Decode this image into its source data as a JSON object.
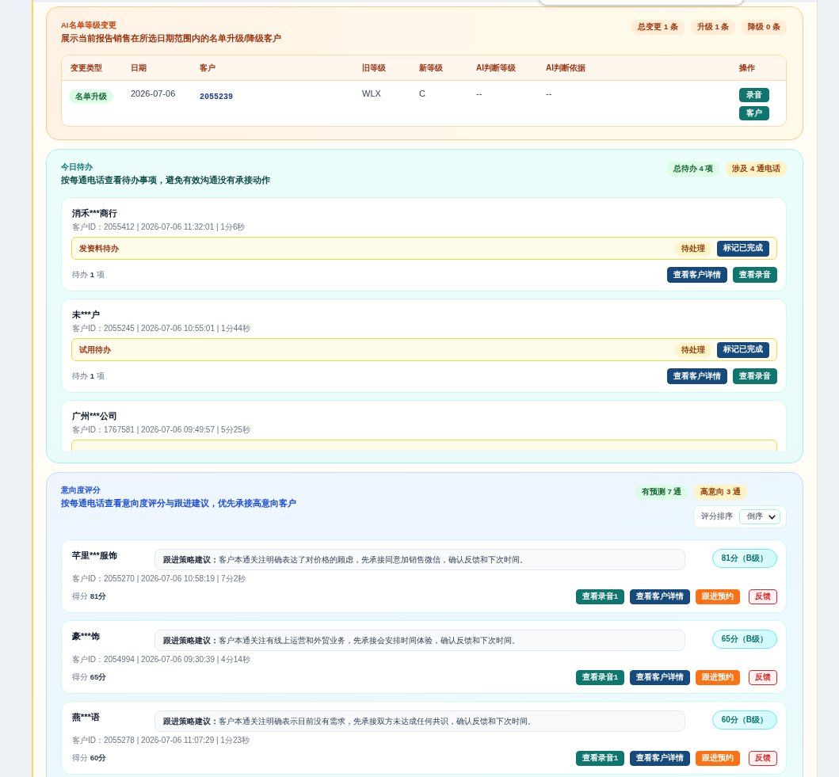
{
  "grade_changes": {
    "title": "AI名单等级变更",
    "subtitle": "展示当前报告销售在所选日期范围内的名单升级/降级客户",
    "badges": [
      {
        "text": "总变更 1 条",
        "color": "#9a3412"
      },
      {
        "text": "升级 1 条",
        "color": "#9a3412"
      },
      {
        "text": "降级 0 条",
        "color": "#9a3412"
      }
    ],
    "table": {
      "columns": [
        "变更类型",
        "日期",
        "客户",
        "旧等级",
        "新等级",
        "AI判断等级",
        "AI判断依据",
        "操作"
      ],
      "rows": [
        {
          "change_type": {
            "text": "名单升级",
            "color": "#166534"
          },
          "date": "2026-07-06",
          "customer": "2055239",
          "old_grade": "WLX",
          "new_grade": "C",
          "ai_grade": "--",
          "ai_basis": "--",
          "actions": [
            {
              "label": "录音",
              "kind": "filled",
              "color": "#0f766e"
            },
            {
              "label": "客户",
              "kind": "filled",
              "color": "#0f766e"
            }
          ]
        }
      ]
    }
  },
  "todos": {
    "title": "今日待办",
    "subtitle": "按每通电话查看待办事项，避免有效沟通没有承接动作",
    "badges": [
      {
        "text": "总待办 4 项",
        "color": "#166534"
      },
      {
        "text": "涉及 4 通电话",
        "color": "#92400e"
      }
    ],
    "cards": [
      {
        "name": "消禾***商行",
        "meta": "客户ID：2055412 | 2026-07-06 11:32:01 | 1分6秒",
        "todos": [
          {
            "kind": "task",
            "title": "发资料待办",
            "status": "待处理",
            "action": "标记已完成"
          }
        ],
        "summary": "待办 **1** 项",
        "buttons": [
          {
            "label": "查看客户详情",
            "kind": "filled",
            "color": "#174a7c"
          },
          {
            "label": "查看录音",
            "kind": "filled",
            "color": "#0f766e"
          }
        ]
      },
      {
        "name": "未***户",
        "meta": "客户ID：2055245 | 2026-07-06 10:55:01 | 1分44秒",
        "todos": [
          {
            "kind": "task",
            "title": "试用待办",
            "status": "待处理",
            "action": "标记已完成"
          }
        ],
        "summary": "待办 **1** 项",
        "buttons": [
          {
            "label": "查看客户详情",
            "kind": "filled",
            "color": "#174a7c"
          },
          {
            "label": "查看录音",
            "kind": "filled",
            "color": "#0f766e"
          }
        ]
      },
      {
        "name": "广州***公司",
        "meta": "客户ID：1767581 | 2026-07-06 09:49:57 | 5分25秒",
        "todos": [
          {
            "kind": "clipped"
          }
        ]
      }
    ]
  },
  "intent": {
    "title": "意向度评分",
    "subtitle": "按每通电话查看意向度评分与跟进建议，优先承接高意向客户",
    "badges": [
      {
        "text": "有预测 7 通",
        "color": "#166534"
      },
      {
        "text": "高意向 3 通",
        "color": "#92400e"
      }
    ],
    "sort": {
      "label": "评分排序",
      "value": "倒序"
    },
    "cards": [
      {
        "name": "芊里***服饰",
        "strategy": "**跟进策略建议：**客户本通关注明确表达了对价格的顾虑，先承接同意加销售微信，确认反馈和下次时间。",
        "score": "81分（B级）",
        "meta": "客户ID：2055270 | 2026-07-06 10:58:19 | 7分2秒",
        "summary": "得分 **81分**",
        "buttons": [
          {
            "label": "查看录音1",
            "kind": "filled",
            "color": "#0f766e"
          },
          {
            "label": "查看客户详情",
            "kind": "filled",
            "color": "#174a7c"
          },
          {
            "label": "跟进预约",
            "kind": "filled",
            "color": "#f97316"
          },
          {
            "label": "反馈",
            "kind": "outline",
            "color": "#dc2626"
          }
        ]
      },
      {
        "name": "豪***饰",
        "strategy": "**跟进策略建议：**客户本通关注有线上运营和外贸业务，先承接会安排时间体验，确认反馈和下次时间。",
        "score": "65分（B级）",
        "meta": "客户ID：2054994 | 2026-07-06 09:30:39 | 4分14秒",
        "summary": "得分 **65分**",
        "buttons": [
          {
            "label": "查看录音1",
            "kind": "filled",
            "color": "#0f766e"
          },
          {
            "label": "查看客户详情",
            "kind": "filled",
            "color": "#174a7c"
          },
          {
            "label": "跟进预约",
            "kind": "filled",
            "color": "#f97316"
          },
          {
            "label": "反馈",
            "kind": "outline",
            "color": "#dc2626"
          }
        ]
      },
      {
        "name": "燕***语",
        "strategy": "**跟进策略建议：**客户本通关注明确表示目前没有需求，先承接双方未达成任何共识，确认反馈和下次时间。",
        "score": "60分（B级）",
        "meta": "客户ID：2055278 | 2026-07-06 11:07:29 | 1分23秒",
        "summary": "得分 **60分**",
        "buttons": [
          {
            "label": "查看录音1",
            "kind": "filled",
            "color": "#0f766e"
          },
          {
            "label": "查看客户详情",
            "kind": "filled",
            "color": "#174a7c"
          },
          {
            "label": "跟进预约",
            "kind": "filled",
            "color": "#f97316"
          },
          {
            "label": "反馈",
            "kind": "outline",
            "color": "#dc2626"
          }
        ]
      }
    ]
  }
}
